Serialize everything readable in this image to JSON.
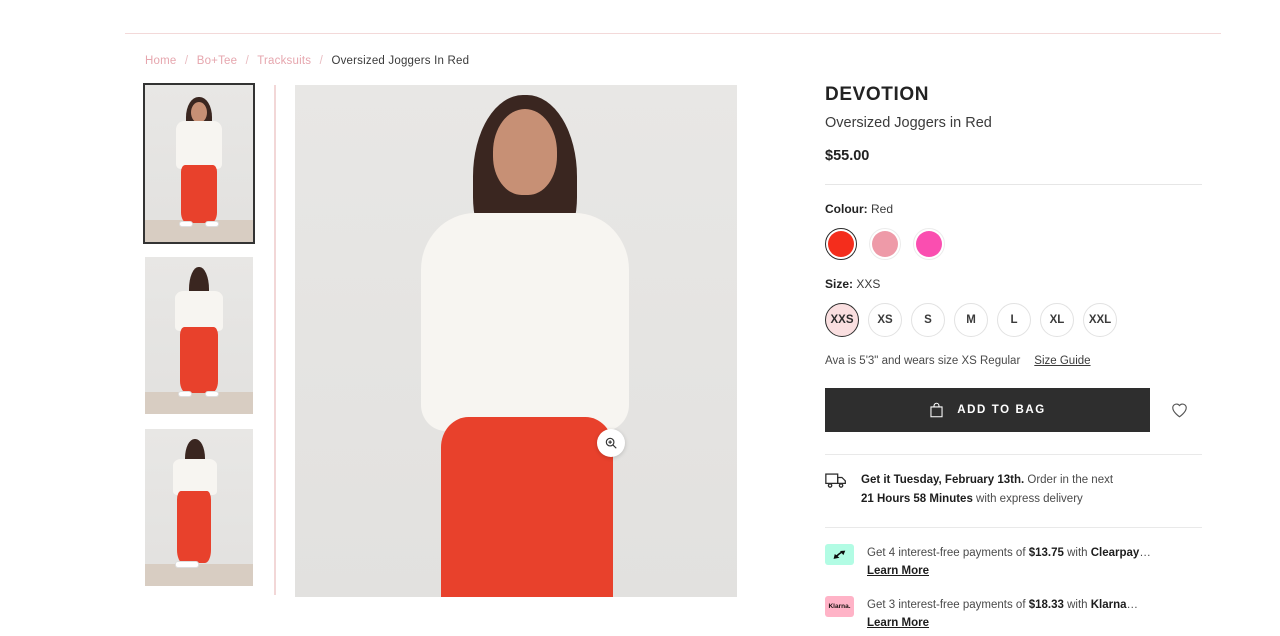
{
  "breadcrumb": {
    "items": [
      {
        "label": "Home",
        "current": false
      },
      {
        "label": "Bo+Tee",
        "current": false
      },
      {
        "label": "Tracksuits",
        "current": false
      },
      {
        "label": "Oversized Joggers In Red",
        "current": true
      }
    ],
    "separator": "/"
  },
  "gallery": {
    "thumbnails": [
      {
        "alt": "Model front view wearing white tee and red joggers",
        "active": true
      },
      {
        "alt": "Model back view wearing white tee and red joggers",
        "active": false
      },
      {
        "alt": "Model side view wearing white tee and red joggers",
        "active": false
      }
    ],
    "main_image_alt": "Model wearing white oversized tee and red oversized joggers",
    "zoom_icon": "magnifier-plus-icon"
  },
  "product": {
    "brand": "DEVOTION",
    "name": "Oversized Joggers in Red",
    "price": "$55.00"
  },
  "colour": {
    "label": "Colour:",
    "selected": "Red",
    "options": [
      {
        "name": "Red",
        "hex": "#F42D1C",
        "selected": true
      },
      {
        "name": "Light Pink",
        "hex": "#EE9AA8",
        "selected": false
      },
      {
        "name": "Hot Pink",
        "hex": "#FA4EB0",
        "selected": false
      }
    ]
  },
  "size": {
    "label": "Size:",
    "selected": "XXS",
    "options": [
      {
        "label": "XXS",
        "selected": true
      },
      {
        "label": "XS",
        "selected": false
      },
      {
        "label": "S",
        "selected": false
      },
      {
        "label": "M",
        "selected": false
      },
      {
        "label": "L",
        "selected": false
      },
      {
        "label": "XL",
        "selected": false
      },
      {
        "label": "XXL",
        "selected": false
      }
    ]
  },
  "model_note": {
    "text": "Ava is 5'3\" and wears size XS Regular",
    "size_guide_label": "Size Guide"
  },
  "actions": {
    "add_to_bag_label": "ADD TO BAG",
    "bag_icon": "shopping-bag-icon",
    "wishlist_icon": "heart-icon"
  },
  "delivery": {
    "icon": "delivery-truck-icon",
    "headline": "Get it Tuesday, February 13th.",
    "middle": " Order in the next",
    "countdown": "21 Hours 58 Minutes",
    "tail": " with express delivery"
  },
  "payments": [
    {
      "provider": "Clearpay",
      "badge_icon": "clearpay-logo-icon",
      "badge_text": "",
      "badge_color": "#B2FCE4",
      "lead": "Get 4 interest-free payments of ",
      "amount": "$13.75",
      "with": " with ",
      "brand": "Clearpay",
      "ellipsis": "…",
      "learn_more": "Learn More"
    },
    {
      "provider": "Klarna",
      "badge_icon": "klarna-logo-icon",
      "badge_text": "Klarna.",
      "badge_color": "#FFB3C7",
      "lead": "Get 3 interest-free payments of ",
      "amount": "$18.33",
      "with": " with ",
      "brand": "Klarna",
      "ellipsis": "…",
      "learn_more": "Learn More"
    }
  ]
}
